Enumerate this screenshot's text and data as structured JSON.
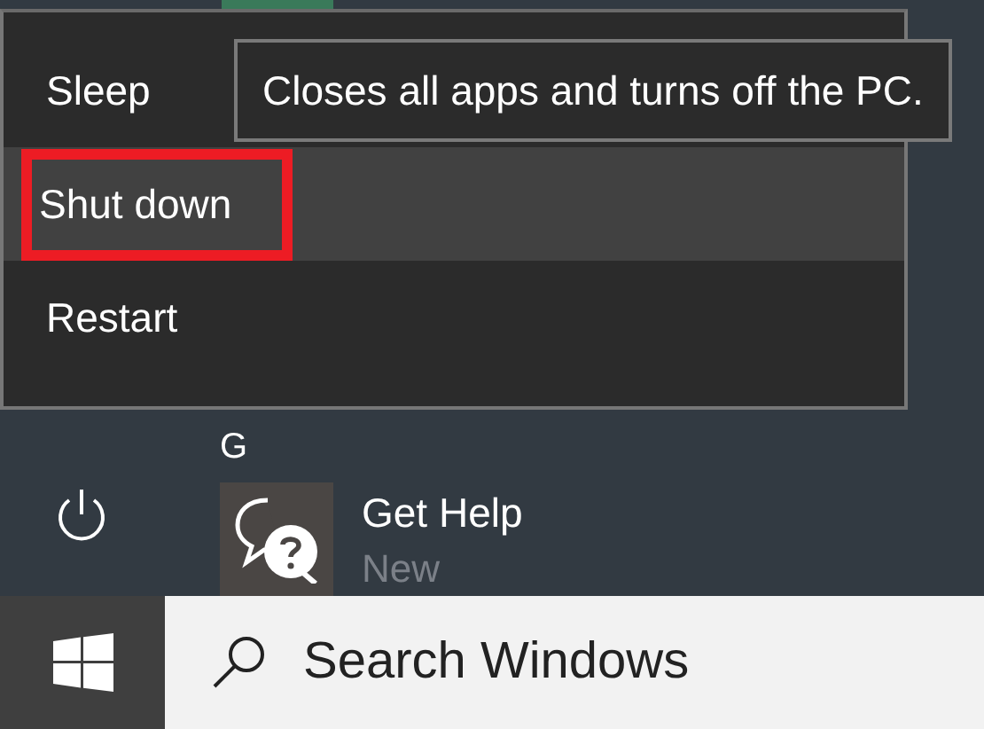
{
  "power_menu": {
    "items": [
      {
        "label": "Sleep",
        "selected": false,
        "outlined": false
      },
      {
        "label": "Shut down",
        "selected": true,
        "outlined": true
      },
      {
        "label": "Restart",
        "selected": false,
        "outlined": false
      }
    ]
  },
  "tooltip": {
    "text": "Closes all apps and turns off the PC."
  },
  "app_list": {
    "group_letter": "G",
    "apps": [
      {
        "name": "Get Help",
        "badge": "New"
      }
    ]
  },
  "taskbar": {
    "search": {
      "placeholder": "Search Windows"
    }
  }
}
